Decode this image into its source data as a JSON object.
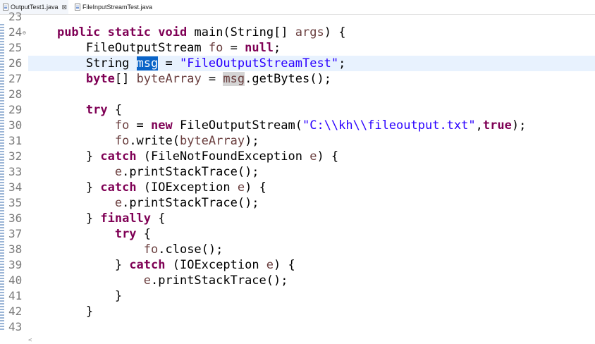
{
  "tabs": [
    {
      "label": "OutputTest1.java",
      "active": true
    },
    {
      "label": "FileInputStreamTest.java",
      "active": false
    }
  ],
  "close_symbol": "⊠",
  "line_numbers": [
    "23",
    "24",
    "25",
    "26",
    "27",
    "28",
    "29",
    "30",
    "31",
    "32",
    "33",
    "34",
    "35",
    "36",
    "37",
    "38",
    "39",
    "40",
    "41",
    "42",
    "43"
  ],
  "code": {
    "l24": {
      "indent": "    ",
      "t1": "public",
      "t2": " ",
      "t3": "static",
      "t4": " ",
      "t5": "void",
      "t6": " main(String[] ",
      "t7": "args",
      "t8": ") {"
    },
    "l25": {
      "indent": "        ",
      "t1": "FileOutputStream ",
      "t2": "fo",
      "t3": " = ",
      "t4": "null",
      "t5": ";"
    },
    "l26": {
      "indent": "        ",
      "t1": "String ",
      "t2": "msg",
      "t3": " = ",
      "t4": "\"FileOutputStreamTest\"",
      "t5": ";"
    },
    "l27": {
      "indent": "        ",
      "t1": "byte",
      "t2": "[] ",
      "t3": "byteArray",
      "t4": " = ",
      "t5": "msg",
      "t6": ".getBytes();"
    },
    "l29": {
      "indent": "        ",
      "t1": "try",
      "t2": " {"
    },
    "l30": {
      "indent": "            ",
      "t1": "fo",
      "t2": " = ",
      "t3": "new",
      "t4": " FileOutputStream(",
      "t5": "\"C:\\\\kh\\\\fileoutput.txt\"",
      "t6": ",",
      "t7": "true",
      "t8": ");"
    },
    "l31": {
      "indent": "            ",
      "t1": "fo",
      "t2": ".write(",
      "t3": "byteArray",
      "t4": ");"
    },
    "l32": {
      "indent": "        ",
      "t1": "} ",
      "t2": "catch",
      "t3": " (FileNotFoundException ",
      "t4": "e",
      "t5": ") {"
    },
    "l33": {
      "indent": "            ",
      "t1": "e",
      "t2": ".printStackTrace();"
    },
    "l34": {
      "indent": "        ",
      "t1": "} ",
      "t2": "catch",
      "t3": " (IOException ",
      "t4": "e",
      "t5": ") {"
    },
    "l35": {
      "indent": "            ",
      "t1": "e",
      "t2": ".printStackTrace();"
    },
    "l36": {
      "indent": "        ",
      "t1": "} ",
      "t2": "finally",
      "t3": " {"
    },
    "l37": {
      "indent": "            ",
      "t1": "try",
      "t2": " {"
    },
    "l38": {
      "indent": "                ",
      "t1": "fo",
      "t2": ".close();"
    },
    "l39": {
      "indent": "            ",
      "t1": "} ",
      "t2": "catch",
      "t3": " (IOException ",
      "t4": "e",
      "t5": ") {"
    },
    "l40": {
      "indent": "                ",
      "t1": "e",
      "t2": ".printStackTrace();"
    },
    "l41": {
      "indent": "            ",
      "t1": "}"
    },
    "l42": {
      "indent": "        ",
      "t1": "}"
    }
  },
  "colors": {
    "keyword": "#7f0055",
    "variable": "#6a3e3e",
    "string": "#2a00ff",
    "selection": "#0a64c8",
    "current_line": "#e8f2fe"
  },
  "scroll_arrow": "<"
}
